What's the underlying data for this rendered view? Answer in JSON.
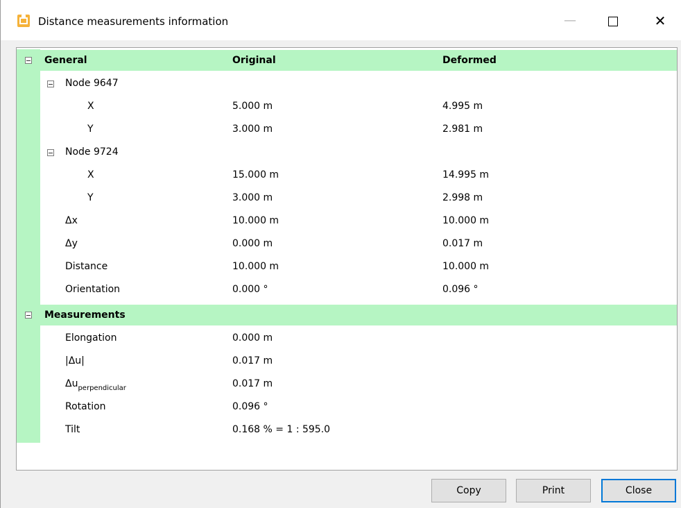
{
  "window": {
    "title": "Distance measurements information",
    "minimize": "—",
    "close": "✕"
  },
  "columns": {
    "general": "General",
    "original": "Original",
    "deformed": "Deformed"
  },
  "node1": {
    "label": "Node 9647",
    "rows": [
      {
        "name": "X",
        "original": "5.000 m",
        "deformed": "4.995 m"
      },
      {
        "name": "Y",
        "original": "3.000 m",
        "deformed": "2.981 m"
      }
    ]
  },
  "node2": {
    "label": "Node 9724",
    "rows": [
      {
        "name": "X",
        "original": "15.000 m",
        "deformed": "14.995 m"
      },
      {
        "name": "Y",
        "original": "3.000 m",
        "deformed": "2.998 m"
      }
    ]
  },
  "general_rows": [
    {
      "name": "Δx",
      "original": "10.000 m",
      "deformed": "10.000 m"
    },
    {
      "name": "Δy",
      "original": "0.000 m",
      "deformed": "0.017 m"
    },
    {
      "name": "Distance",
      "original": "10.000 m",
      "deformed": "10.000 m"
    },
    {
      "name": "Orientation",
      "original": "0.000 °",
      "deformed": "0.096 °"
    }
  ],
  "measurements": {
    "label": "Measurements",
    "rows": [
      {
        "name": "Elongation",
        "value": "0.000 m"
      },
      {
        "name": "|Δu|",
        "value": "0.017 m"
      },
      {
        "name": "Δu",
        "subscript": "perpendicular",
        "value": "0.017 m"
      },
      {
        "name": "Rotation",
        "value": "0.096 °"
      },
      {
        "name": "Tilt",
        "value": "0.168 % = 1 : 595.0"
      }
    ]
  },
  "buttons": {
    "copy": "Copy",
    "print": "Print",
    "close": "Close"
  },
  "colors": {
    "header_bg": "#b6f5c3",
    "default_button_border": "#0078d7"
  },
  "icons": [
    "app-icon",
    "minimize-icon",
    "maximize-icon",
    "close-icon",
    "collapse-icon"
  ]
}
